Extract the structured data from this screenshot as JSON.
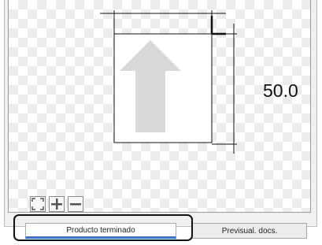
{
  "preview": {
    "dimension_value": "50.0",
    "arrow_icon": "up-arrow-icon"
  },
  "toolbar": {
    "fit_icon": "fit-to-window-icon",
    "zoom_in_icon": "plus-icon",
    "zoom_out_icon": "minus-icon"
  },
  "tabs": [
    {
      "label": "Producto terminado",
      "active": true
    },
    {
      "label": "Previsual. docs.",
      "active": false
    }
  ],
  "colors": {
    "active_tab_underline": "#3b6fd6",
    "arrow_fill": "#d9d9d9"
  }
}
